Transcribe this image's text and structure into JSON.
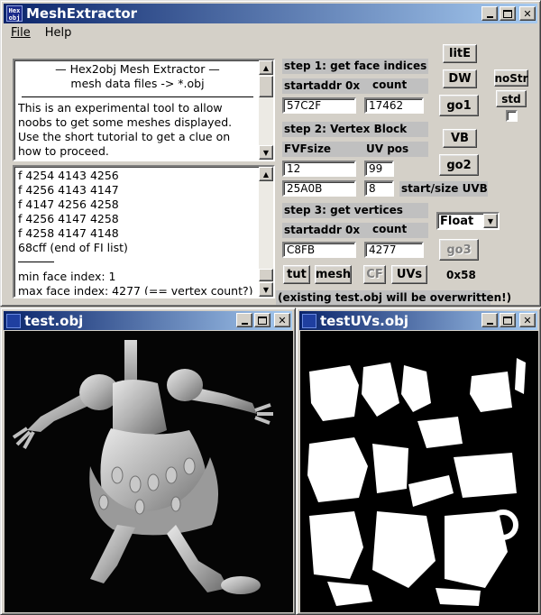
{
  "main_window": {
    "app_icon_text_line1": "Hex",
    "app_icon_text_line2": "obj",
    "title": "MeshExtractor",
    "menu": {
      "file": "File",
      "help": "Help"
    }
  },
  "info_text": {
    "heading": "—    Hex2obj Mesh Extractor    —",
    "subheading": "mesh data files -> *.obj",
    "body_lines": [
      "This is an experimental tool to allow",
      "noobs to get some meshes displayed.",
      "Use the short tutorial to get a clue on",
      "how to proceed."
    ]
  },
  "face_list": {
    "lines": [
      "f  4254 4143 4256",
      "f  4256 4143 4147",
      "f  4147 4256 4258",
      "f  4256 4147 4258",
      "f  4258 4147 4148",
      "68cff (end of FI list)",
      "",
      "min face index: 1",
      "max face index: 4277 (== vertex count?)"
    ]
  },
  "step1": {
    "label": "step 1: get face indices",
    "startaddr_label": "startaddr 0x",
    "count_label": "count",
    "startaddr_value": "57C2F",
    "count_value": "17462"
  },
  "step2": {
    "label": "step 2: Vertex Block",
    "fvfsize_label": "FVFsize",
    "uvpos_label": "UV pos",
    "fvfsize_value": "12",
    "uvpos_value": "99",
    "uvb_start_value": "25A0B",
    "uvb_size_value": "8",
    "uvb_label": "start/size UVB"
  },
  "step3": {
    "label": "step 3: get vertices",
    "startaddr_label": "startaddr 0x",
    "count_label": "count",
    "startaddr_value": "C8FB",
    "count_value": "4277"
  },
  "buttons": {
    "litE": "litE",
    "dw": "DW",
    "go1": "go1",
    "vb": "VB",
    "go2": "go2",
    "go3": "go3",
    "nostr": "noStr",
    "std": "std",
    "tut": "tut",
    "mesh": "mesh",
    "cf": "CF",
    "uvs": "UVs"
  },
  "float_select": {
    "value": "Float"
  },
  "hex_size": "0x58",
  "warning": "(existing test.obj will be overwritten!)",
  "window_test": {
    "title": "test.obj"
  },
  "window_uvs": {
    "title": "testUVs.obj"
  },
  "colors": {
    "titlebar_start": "#0a246a",
    "titlebar_end": "#a6caf0",
    "window_face": "#d4d0c8",
    "viewport_bg": "#000000"
  }
}
